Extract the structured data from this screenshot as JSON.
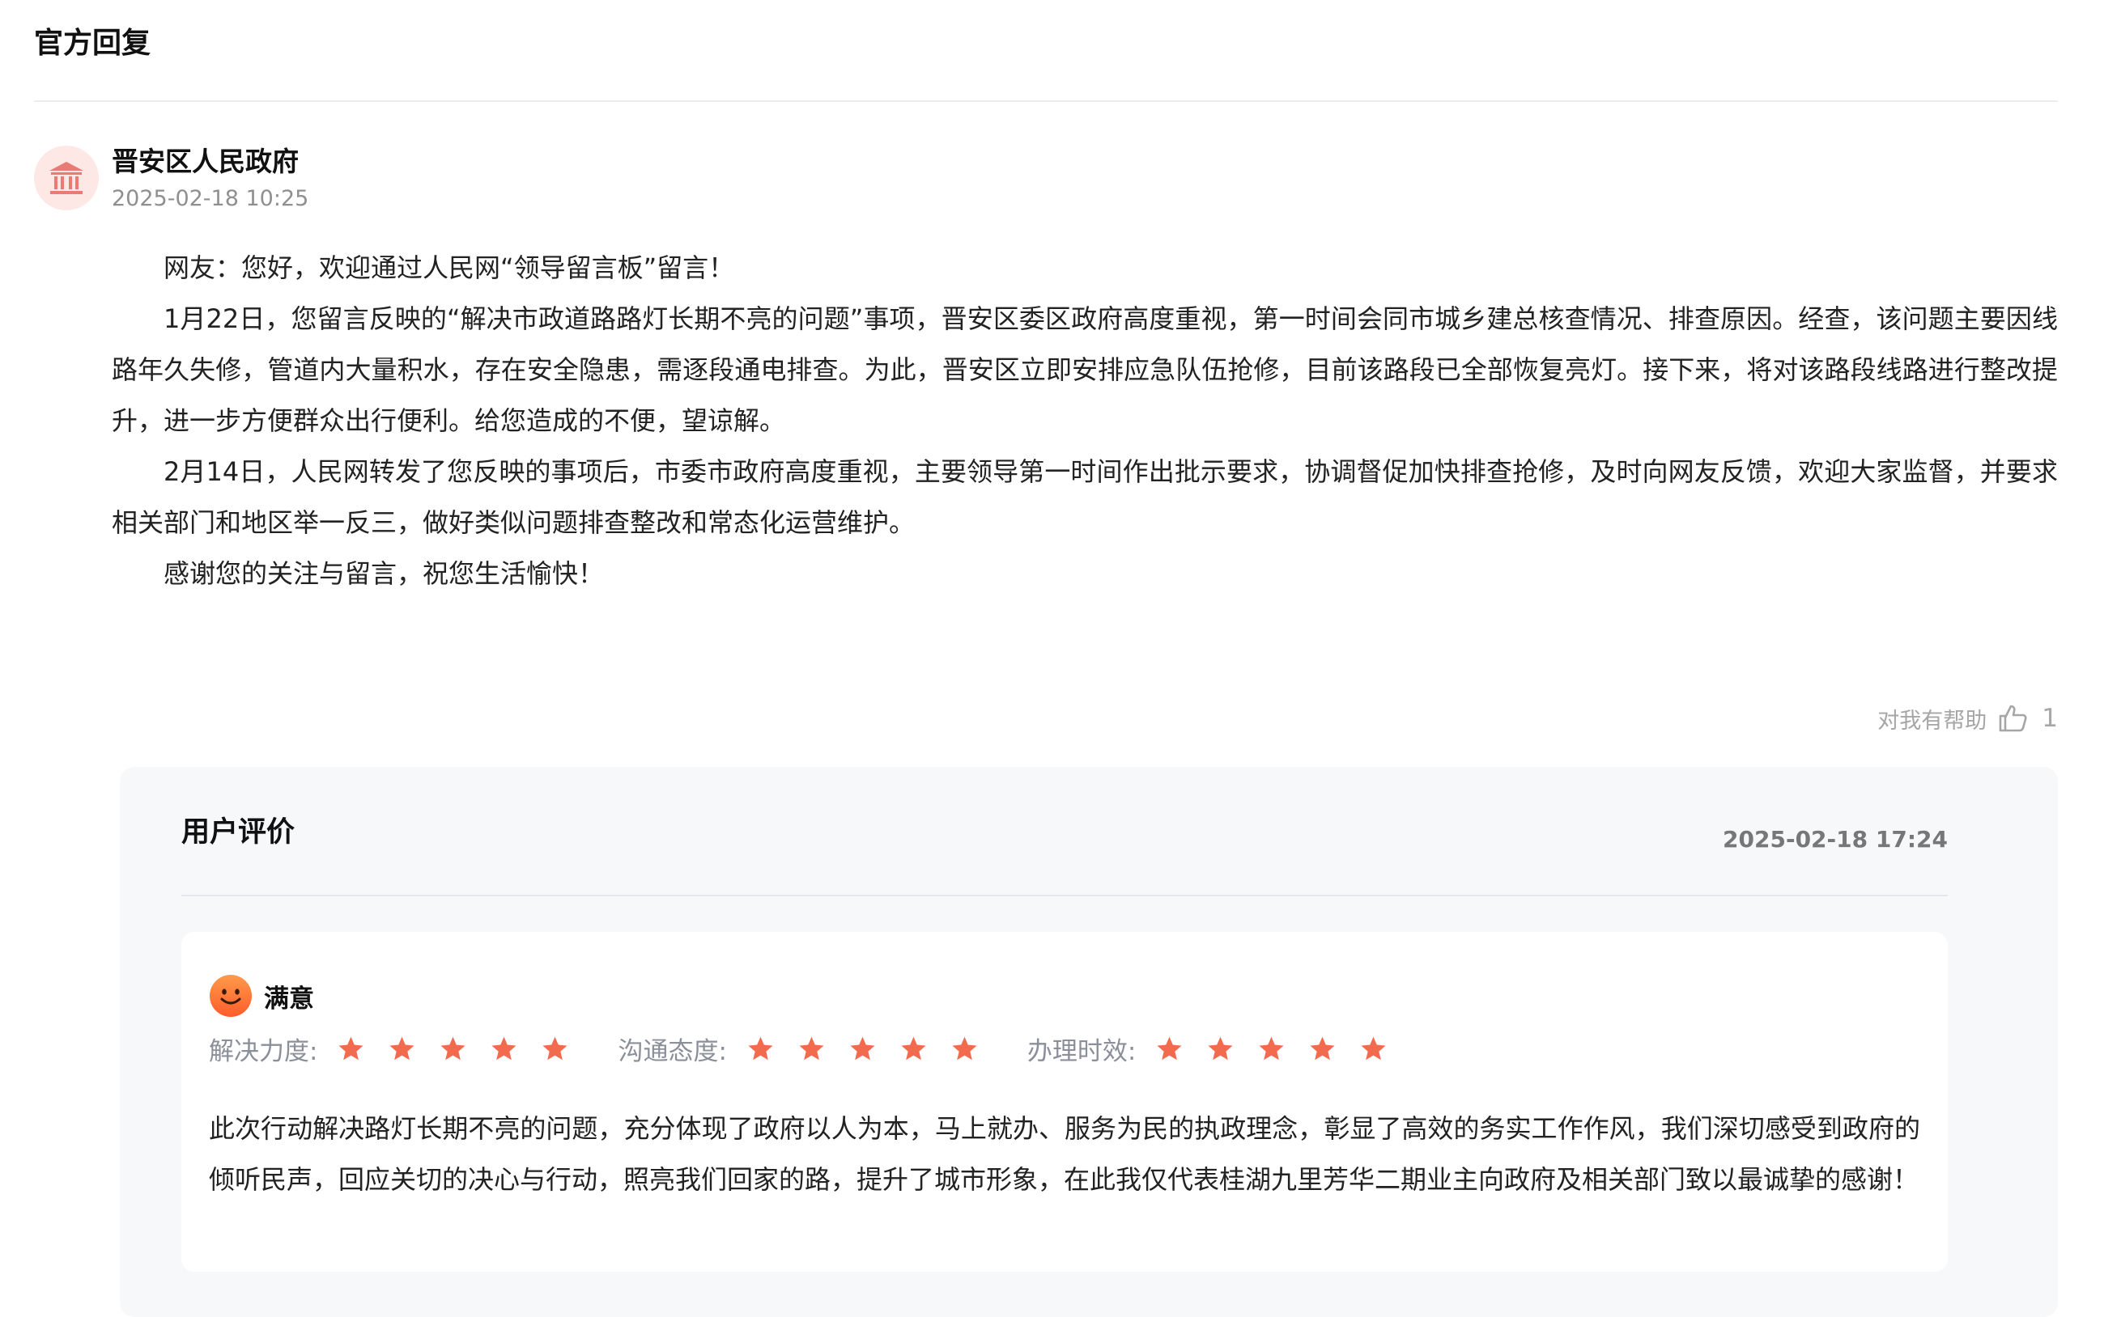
{
  "section": {
    "title": "官方回复"
  },
  "reply": {
    "org_name": "晋安区人民政府",
    "time": "2025-02-18 10:25",
    "avatar_icon": "government-building-icon",
    "paragraphs": [
      "网友：您好，欢迎通过人民网“领导留言板”留言！",
      "1月22日，您留言反映的“解决市政道路路灯长期不亮的问题”事项，晋安区委区政府高度重视，第一时间会同市城乡建总核查情况、排查原因。经查，该问题主要因线路年久失修，管道内大量积水，存在安全隐患，需逐段通电排查。为此，晋安区立即安排应急队伍抢修，目前该路段已全部恢复亮灯。接下来，将对该路段线路进行整改提升，进一步方便群众出行便利。给您造成的不便，望谅解。",
      "2月14日，人民网转发了您反映的事项后，市委市政府高度重视，主要领导第一时间作出批示要求，协调督促加快排查抢修，及时向网友反馈，欢迎大家监督，并要求相关部门和地区举一反三，做好类似问题排查整改和常态化运营维护。",
      "感谢您的关注与留言，祝您生活愉快！"
    ],
    "helpful": {
      "label": "对我有帮助",
      "count": "1",
      "icon": "thumbs-up-icon"
    }
  },
  "evaluation": {
    "title": "用户评价",
    "time": "2025-02-18 17:24",
    "satisfaction": {
      "label": "满意",
      "icon": "smiley-face-icon"
    },
    "ratings": [
      {
        "label": "解决力度:",
        "stars": 5
      },
      {
        "label": "沟通态度:",
        "stars": 5
      },
      {
        "label": "办理时效:",
        "stars": 5
      }
    ],
    "comment": "此次行动解决路灯长期不亮的问题，充分体现了政府以人为本，马上就办、服务为民的执政理念，彰显了高效的务实工作作风，我们深切感受到政府的倾听民声，回应关切的决心与行动，照亮我们回家的路，提升了城市形象，在此我仅代表桂湖九里芳华二期业主向政府及相关部门致以最诚挚的感谢！"
  },
  "colors": {
    "star": "#f26b4f",
    "avatar_bg": "#fde8e6",
    "avatar_icon": "#ea7b74",
    "panel_bg": "#f7f8fa",
    "smiley": "#ff7a3d"
  }
}
